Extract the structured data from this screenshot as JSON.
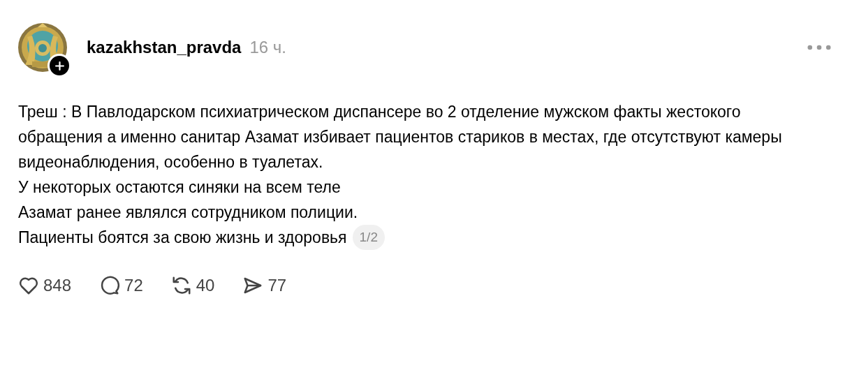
{
  "post": {
    "username": "kazakhstan_pravda",
    "time": "16 ч.",
    "paragraphs": [
      "Треш : В Павлодарском психиатрическом диспансере во 2 отделение мужском факты жестокого обращения а именно санитар Азамат избивает пациентов стариков в местах, где отсутствуют камеры видеонаблюдения, особенно в туалетах.",
      "У некоторых остаются синяки на всем теле",
      "Азамат ранее являлся сотрудником полиции.",
      "Пациенты боятся за свою жизнь и здоровья"
    ],
    "page_indicator": "1/2",
    "actions": [
      {
        "kind": "like",
        "count": "848"
      },
      {
        "kind": "comment",
        "count": "72"
      },
      {
        "kind": "repost",
        "count": "40"
      },
      {
        "kind": "share",
        "count": "77"
      }
    ]
  }
}
